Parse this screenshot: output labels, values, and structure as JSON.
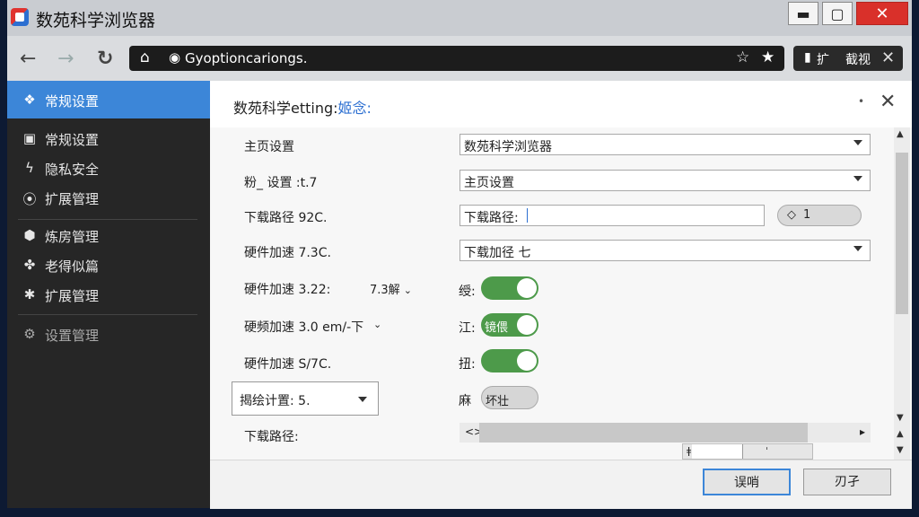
{
  "window": {
    "title": "数苑科学浏览器",
    "min_label": "▬",
    "max_label": "▢",
    "close_label": "✕"
  },
  "toolbar": {
    "url": "Gyoptioncariongs.",
    "tab_label": "扩",
    "tab_label2": "截视",
    "tab_close": "✕"
  },
  "sidebar": {
    "items": [
      {
        "icon": "❖",
        "label": "常规设置"
      },
      {
        "icon": "▣",
        "label": "常规设置"
      },
      {
        "icon": "ϟ",
        "label": "隐私安全"
      },
      {
        "icon": "⦿",
        "label": "扩展管理"
      },
      {
        "icon": "⬢",
        "label": "炼房管理"
      },
      {
        "icon": "✤",
        "label": "老得似篇"
      },
      {
        "icon": "✱",
        "label": "扩展管理"
      },
      {
        "icon": "⚙",
        "label": "设置管理"
      }
    ]
  },
  "panel": {
    "title_main": "数苑科学etting:",
    "title_accent": "姬念:",
    "dot": "•",
    "close": "✕"
  },
  "rows": {
    "r1_label": "主页设置",
    "r1_value": "数苑科学浏览器",
    "r2_label": "粉_ 设置 :t.7",
    "r2_value": "主页设置",
    "r3_label": "下载路径 92C.",
    "r3_input_label": "下载路径:",
    "r3_button_icon": "◇",
    "r3_button_text": "1",
    "r4_label": "硬件加速 7.3C.",
    "r4_value": "下载加径 七",
    "r5_label": "硬件加速 3.22:",
    "r5_extra": "7.3解",
    "r5_toggle_label": "绶:",
    "r6_label": "硬频加速 3.0 em/-下",
    "r6_toggle_label": "江:",
    "r6_toggle_text": "镜偎",
    "r7_label": "硬件加速 S/7C.",
    "r7_toggle_label": "扭:",
    "r8_select": "揭绘计置: 5.",
    "r8_toggle_label": "麻",
    "r8_toggle_text": "坏壮",
    "r9_label": "下载路径:",
    "slider_left": "<>",
    "slider_right": "▸",
    "slider_value_fraction": 0.82,
    "mini_left": "ǂ",
    "mini_right": "ˈ"
  },
  "footer": {
    "ok_label": "误哨",
    "cancel_label": "刃孑"
  }
}
